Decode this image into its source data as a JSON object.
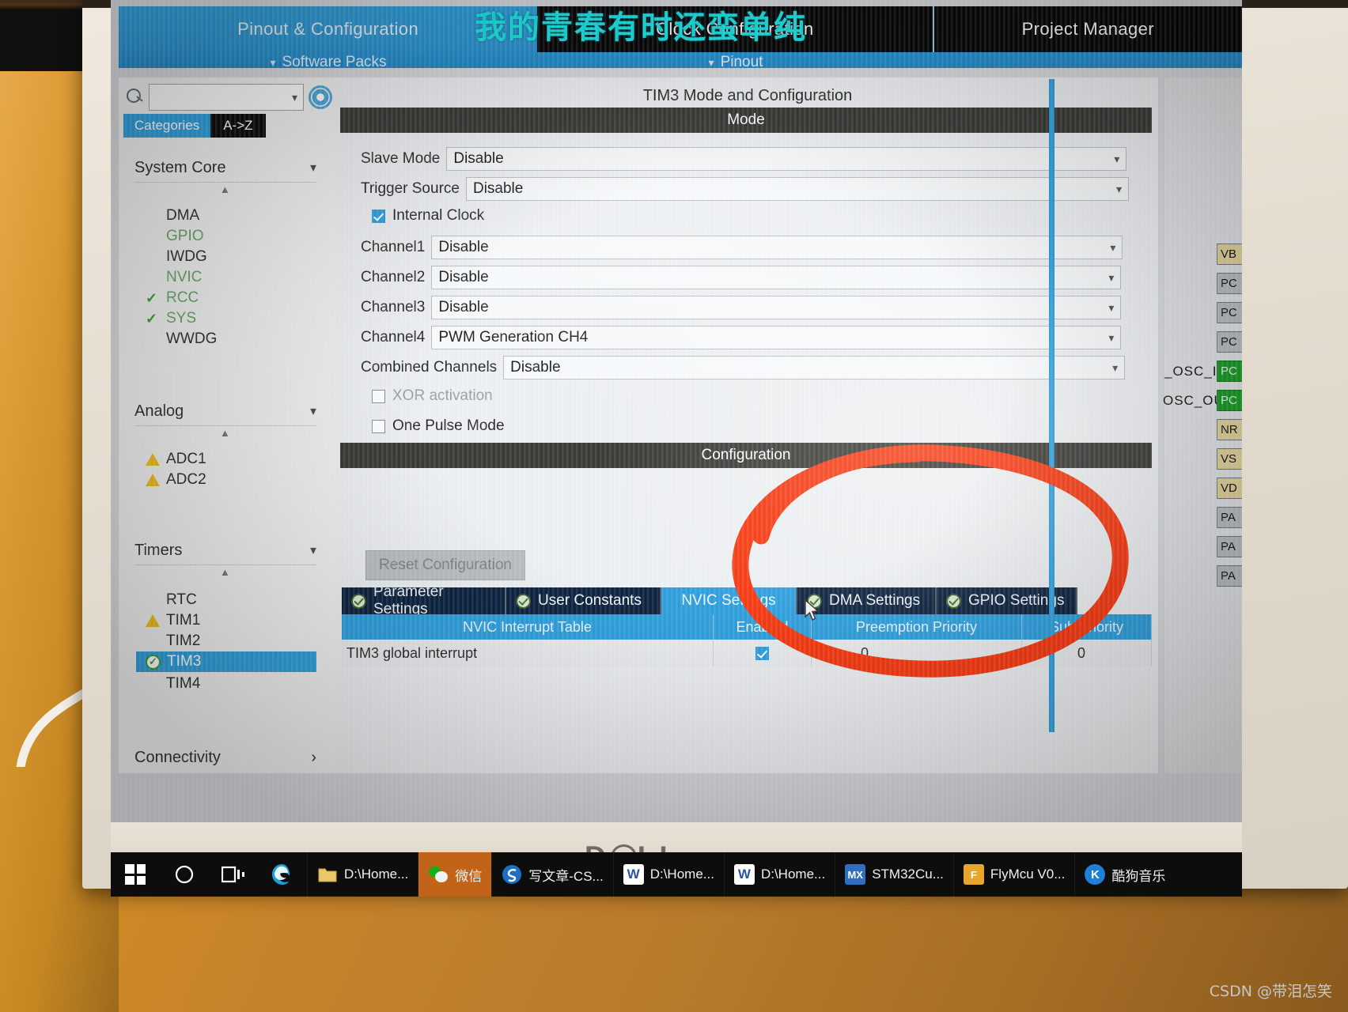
{
  "window_title_overlay": "我的青春有时还蛮单纯",
  "header": {
    "tabs": [
      {
        "label": "Pinout & Configuration",
        "active": true
      },
      {
        "label": "Clock Configuration",
        "active": false
      },
      {
        "label": "Project Manager",
        "active": false
      }
    ],
    "sub_items": [
      {
        "label": "Software Packs",
        "icon": "chevron-down-icon"
      },
      {
        "label": "Pinout",
        "icon": "chevron-down-icon"
      }
    ]
  },
  "sidebar": {
    "search_placeholder": "",
    "search_value": "",
    "gear_icon": "gear-icon",
    "search_icon": "search-icon",
    "view_buttons": [
      {
        "label": "Categories",
        "selected": true
      },
      {
        "label": "A->Z",
        "selected": false
      }
    ],
    "groups": [
      {
        "name": "System Core",
        "chevron": "chevron-down-icon",
        "items": [
          {
            "label": "DMA",
            "status": "none"
          },
          {
            "label": "GPIO",
            "status": "configured-green"
          },
          {
            "label": "IWDG",
            "status": "none"
          },
          {
            "label": "NVIC",
            "status": "configured-green"
          },
          {
            "label": "RCC",
            "status": "check"
          },
          {
            "label": "SYS",
            "status": "check"
          },
          {
            "label": "WWDG",
            "status": "none"
          }
        ]
      },
      {
        "name": "Analog",
        "chevron": "chevron-down-icon",
        "items": [
          {
            "label": "ADC1",
            "status": "warning"
          },
          {
            "label": "ADC2",
            "status": "warning"
          }
        ]
      },
      {
        "name": "Timers",
        "chevron": "chevron-down-icon",
        "items": [
          {
            "label": "RTC",
            "status": "none"
          },
          {
            "label": "TIM1",
            "status": "warning"
          },
          {
            "label": "TIM2",
            "status": "none"
          },
          {
            "label": "TIM3",
            "status": "ok-selected"
          },
          {
            "label": "TIM4",
            "status": "none"
          }
        ]
      }
    ],
    "footer_group": {
      "name": "Connectivity",
      "chevron": "chevron-right-icon"
    }
  },
  "main": {
    "panel_title": "TIM3 Mode and Configuration",
    "mode_header": "Mode",
    "config_header": "Configuration",
    "mode_rows": [
      {
        "label": "Slave Mode",
        "value": "Disable",
        "type": "combo"
      },
      {
        "label": "Trigger Source",
        "value": "Disable",
        "type": "combo"
      },
      {
        "label": "Internal Clock",
        "value": "",
        "type": "checkbox",
        "checked": true
      },
      {
        "label": "Channel1",
        "value": "Disable",
        "type": "combo"
      },
      {
        "label": "Channel2",
        "value": "Disable",
        "type": "combo"
      },
      {
        "label": "Channel3",
        "value": "Disable",
        "type": "combo"
      },
      {
        "label": "Channel4",
        "value": "PWM Generation CH4",
        "type": "combo"
      },
      {
        "label": "Combined Channels",
        "value": "Disable",
        "type": "combo"
      },
      {
        "label": "XOR activation",
        "value": "",
        "type": "checkbox",
        "checked": false,
        "disabled": true
      },
      {
        "label": "One Pulse Mode",
        "value": "",
        "type": "checkbox",
        "checked": false
      }
    ],
    "reset_button": "Reset Configuration",
    "settings_tabs": [
      {
        "label": "Parameter Settings",
        "active": false
      },
      {
        "label": "User Constants",
        "active": false
      },
      {
        "label": "NVIC Settings",
        "active": true
      },
      {
        "label": "DMA Settings",
        "active": false
      },
      {
        "label": "GPIO Settings",
        "active": false
      }
    ],
    "nvic_table": {
      "columns": [
        "NVIC Interrupt Table",
        "Enabled",
        "Preemption Priority",
        "Sub Priority"
      ],
      "rows": [
        {
          "name": "TIM3 global interrupt",
          "enabled": true,
          "preemption_priority": "0",
          "sub_priority": "0"
        }
      ]
    }
  },
  "right_panel": {
    "pin_labels": [
      "_OSC_IN",
      "OSC_OUT"
    ],
    "pins": [
      {
        "label": "VB",
        "color": "tan"
      },
      {
        "label": "PC",
        "color": "gray"
      },
      {
        "label": "PC",
        "color": "gray"
      },
      {
        "label": "PC",
        "color": "gray"
      },
      {
        "label": "PC",
        "color": "green"
      },
      {
        "label": "PC",
        "color": "green"
      },
      {
        "label": "NR",
        "color": "tan"
      },
      {
        "label": "VS",
        "color": "tan"
      },
      {
        "label": "VD",
        "color": "tan"
      },
      {
        "label": "PA",
        "color": "gray"
      },
      {
        "label": "PA",
        "color": "gray"
      },
      {
        "label": "PA",
        "color": "gray"
      }
    ],
    "zoom_icon": "zoom-in-icon"
  },
  "taskbar": {
    "system_icons": [
      "windows-start-icon",
      "search-icon",
      "task-view-icon",
      "edge-browser-icon"
    ],
    "tasks": [
      {
        "icon": "folder-icon",
        "label": "D:\\Home...",
        "active": false
      },
      {
        "icon": "wechat-icon",
        "label": "微信",
        "active": true
      },
      {
        "icon": "sogou-icon",
        "label": "写文章-CS...",
        "active": false
      },
      {
        "icon": "word-icon",
        "label": "D:\\Home...",
        "active": false
      },
      {
        "icon": "word-icon",
        "label": "D:\\Home...",
        "active": false
      },
      {
        "icon": "stm32cubemx-icon",
        "label": "STM32Cu...",
        "active": false
      },
      {
        "icon": "flymcu-icon",
        "label": "FlyMcu V0...",
        "active": false
      },
      {
        "icon": "kugou-icon",
        "label": "酷狗音乐",
        "active": false
      }
    ]
  },
  "laptop": {
    "brand": "DELL"
  },
  "watermark": "CSDN @带泪怎笑",
  "annotation": {
    "shape": "red-ellipse-highlight",
    "color": "#f43a12"
  }
}
